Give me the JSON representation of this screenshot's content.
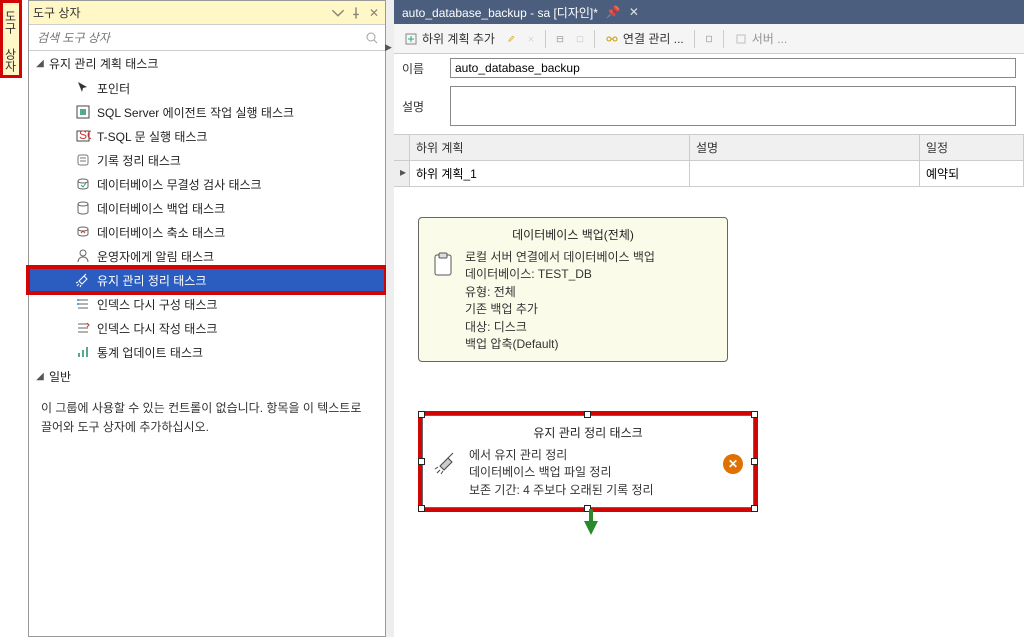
{
  "vert_tab_label": "도구 상자",
  "toolbox": {
    "title": "도구 상자",
    "search_placeholder": "검색 도구 상자",
    "group1_header": "유지 관리 계획 태스크",
    "items": [
      {
        "label": "포인터",
        "icon": "pointer-icon"
      },
      {
        "label": "SQL Server 에이전트 작업 실행 태스크",
        "icon": "agent-job-icon"
      },
      {
        "label": "T-SQL 문 실행 태스크",
        "icon": "tsql-icon"
      },
      {
        "label": "기록 정리 태스크",
        "icon": "history-cleanup-icon"
      },
      {
        "label": "데이터베이스 무결성 검사 태스크",
        "icon": "integrity-icon"
      },
      {
        "label": "데이터베이스 백업 태스크",
        "icon": "backup-icon"
      },
      {
        "label": "데이터베이스 축소 태스크",
        "icon": "shrink-icon"
      },
      {
        "label": "운영자에게 알림 태스크",
        "icon": "notify-operator-icon"
      },
      {
        "label": "유지 관리 정리 태스크",
        "icon": "broom-icon"
      },
      {
        "label": "인덱스 다시 구성 태스크",
        "icon": "reorg-index-icon"
      },
      {
        "label": "인덱스 다시 작성 태스크",
        "icon": "rebuild-index-icon"
      },
      {
        "label": "통계 업데이트 태스크",
        "icon": "update-stats-icon"
      }
    ],
    "group2_header": "일반",
    "general_msg": "이 그룹에 사용할 수 있는 컨트롤이 없습니다. 항목을 이 텍스트로 끌어와 도구 상자에 추가하십시오."
  },
  "doc": {
    "tab_title": "auto_database_backup - sa [디자인]*",
    "toolbar": {
      "add_subplan": "하위 계획 추가",
      "manage_conn": "연결 관리 ...",
      "server": "서버 ..."
    },
    "form": {
      "name_label": "이름",
      "name_value": "auto_database_backup",
      "desc_label": "설명",
      "desc_value": ""
    },
    "grid": {
      "col_a": "하위 계획",
      "col_b": "설명",
      "col_c": "일정",
      "row1_a": "하위 계획_1",
      "row1_b": "",
      "row1_c": "예약되"
    },
    "node1": {
      "title": "데이터베이스 백업(전체)",
      "l1": "로컬 서버 연결에서 데이터베이스 백업",
      "l2": "데이터베이스: TEST_DB",
      "l3": "유형: 전체",
      "l4": "기존 백업 추가",
      "l5": "대상: 디스크",
      "l6": "백업 압축(Default)"
    },
    "node2": {
      "title": "유지 관리 정리 태스크",
      "l1": "에서 유지 관리 정리",
      "l2": "데이터베이스 백업 파일 정리",
      "l3": "보존 기간: 4 주보다 오래된 기록 정리"
    }
  }
}
